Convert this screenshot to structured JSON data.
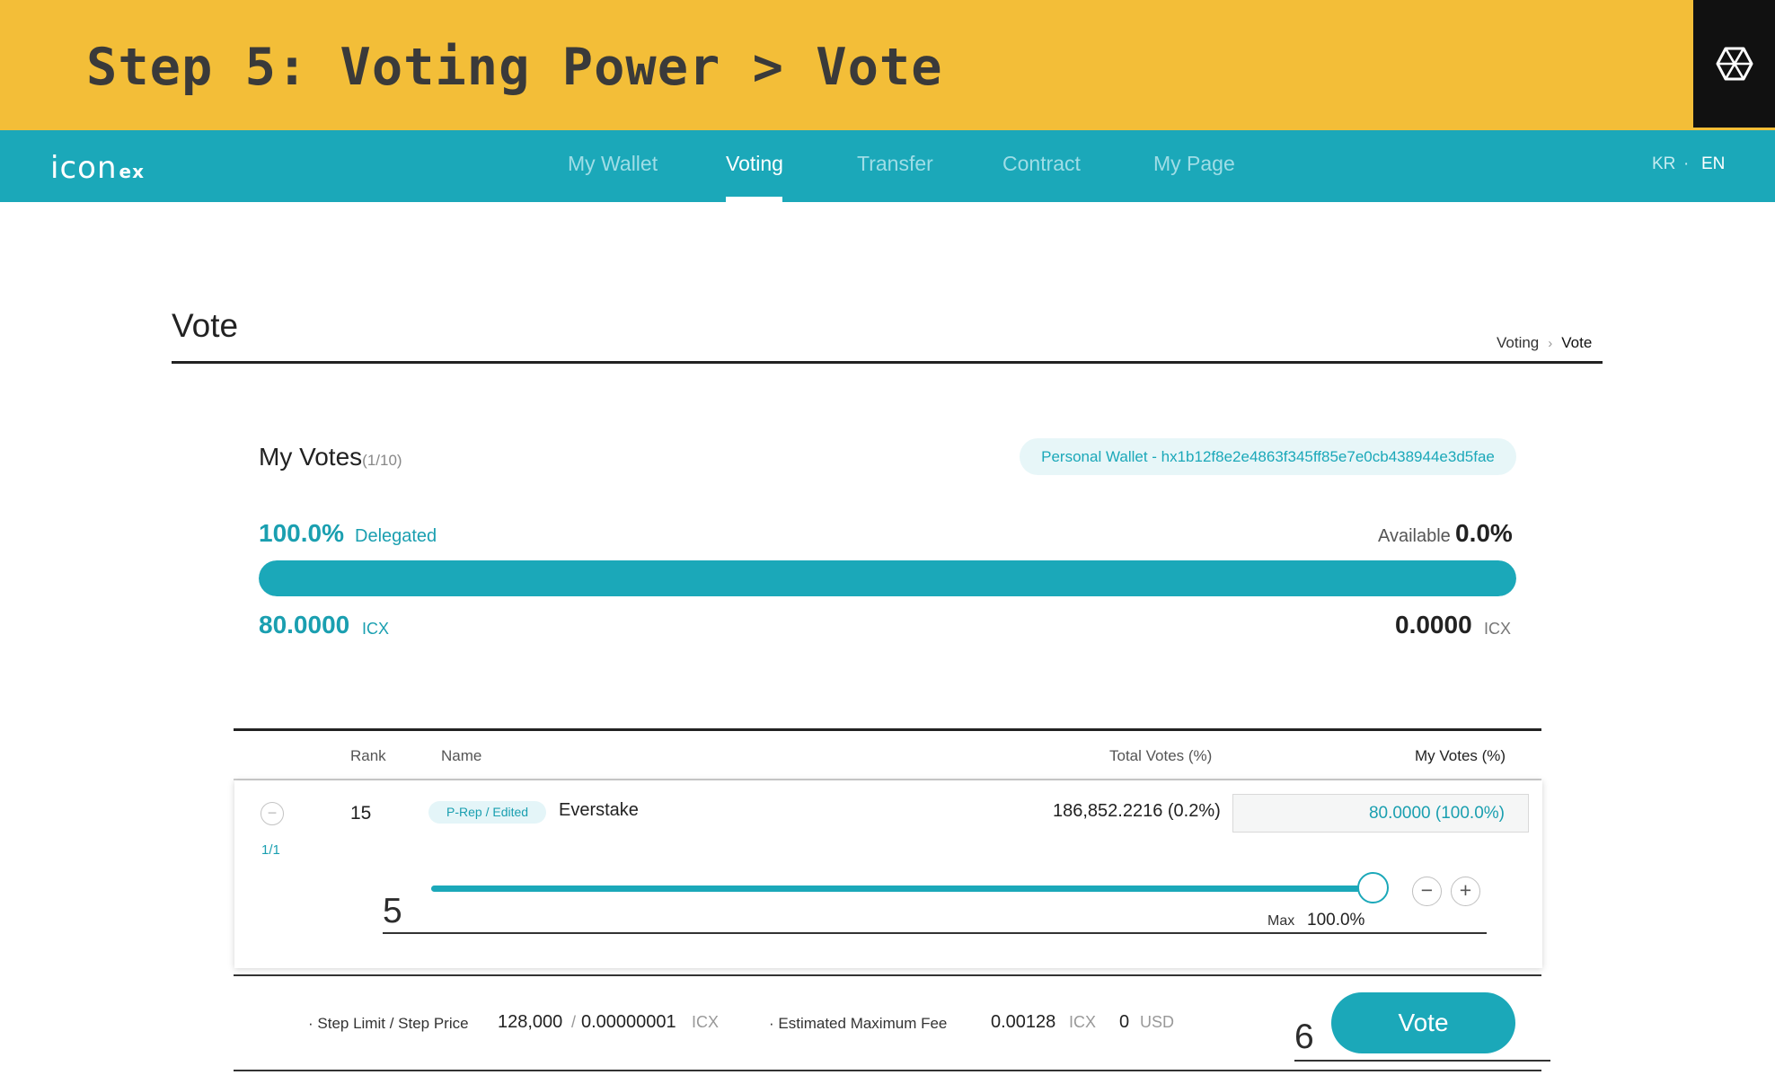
{
  "banner": {
    "title": "Step 5: Voting Power > Vote",
    "logo_icon": "hexagon-logo-icon"
  },
  "nav": {
    "logo_main": "icon",
    "logo_suffix": "ex",
    "items": [
      {
        "label": "My Wallet",
        "active": false
      },
      {
        "label": "Voting",
        "active": true
      },
      {
        "label": "Transfer",
        "active": false
      },
      {
        "label": "Contract",
        "active": false
      },
      {
        "label": "My Page",
        "active": false
      }
    ],
    "languages": [
      {
        "label": "KR",
        "active": false
      },
      {
        "label": "EN",
        "active": true
      }
    ],
    "lang_separator": "·"
  },
  "page": {
    "title": "Vote",
    "breadcrumb": {
      "parent": "Voting",
      "current": "Vote"
    }
  },
  "summary": {
    "title": "My Votes",
    "count": "(1/10)",
    "wallet_label": "Personal Wallet - hx1b12f8e2e4863f345ff85e7e0cb438944e3d5fae",
    "delegated_pct": "100.0%",
    "delegated_label": "Delegated",
    "available_label": "Available",
    "available_pct": "0.0%",
    "delegated_fraction": 1.0,
    "delegated_icx": "80.0000",
    "available_icx": "0.0000",
    "unit": "ICX"
  },
  "table": {
    "headers": {
      "rank": "Rank",
      "name": "Name",
      "total_votes": "Total Votes (%)",
      "my_votes": "My Votes (%)"
    },
    "rows": [
      {
        "page": "1/1",
        "rank": "15",
        "badge": "P-Rep / Edited",
        "name": "Everstake",
        "total_votes": "186,852.2216 (0.2%)",
        "my_votes": "80.0000 (100.0%)",
        "slider_fraction": 1.0,
        "max_label": "Max",
        "max_value": "100.0%"
      }
    ]
  },
  "callouts": {
    "slider": "5",
    "vote": "6"
  },
  "fee": {
    "step_label": "· Step Limit / Step Price",
    "step_limit": "128,000",
    "separator": "/",
    "step_price": "0.00000001",
    "step_unit": "ICX",
    "est_label": "· Estimated Maximum Fee",
    "est_value": "0.00128",
    "est_unit": "ICX",
    "usd_value": "0",
    "usd_unit": "USD"
  },
  "actions": {
    "vote_label": "Vote"
  },
  "colors": {
    "accent": "#1ba8b9",
    "banner": "#f3be38",
    "header_bg": "#1ba8b9"
  }
}
